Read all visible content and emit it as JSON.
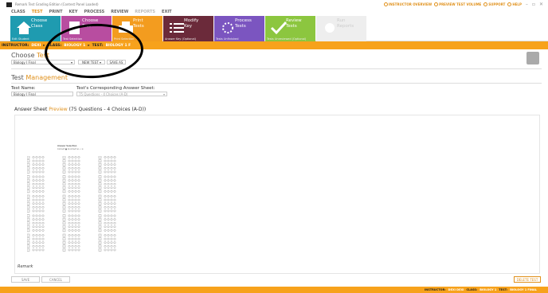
{
  "window": {
    "title": "Remark Test Grading Edition (Contest Panel Loaded)"
  },
  "titlebar_right": {
    "instructor_label": "INSTRUCTOR OVERVIEW",
    "user_label": "PREVIEW TEST VOLUME",
    "support_label": "SUPPORT",
    "help_label": "HELP"
  },
  "menu": [
    "CLASS",
    "TEST",
    "PRINT",
    "KEY",
    "PROCESS",
    "REVIEW",
    "REPORTS",
    "EXIT"
  ],
  "ribbon": [
    {
      "title": "Choose\nClass",
      "sub": "Edit Student",
      "color": "#1f9bb0",
      "icon": "home-icon"
    },
    {
      "title": "Choose\nTest",
      "sub": "Test Selection",
      "color": "#b84da0",
      "icon": "document-icon"
    },
    {
      "title": "Print\nTests",
      "sub": "Print Selection",
      "color": "#f39c1f",
      "icon": "printer-icon"
    },
    {
      "title": "Modify\nKey",
      "sub": "Answer Key (Optional)",
      "color": "#6b2a3a",
      "icon": "list-icon"
    },
    {
      "title": "Process\nTests",
      "sub": "Tests Unfinished",
      "color": "#7b55c0",
      "icon": "process-icon"
    },
    {
      "title": "Review\nTests",
      "sub": "Tests Unreviewed (Optional)",
      "color": "#8cc63f",
      "icon": "check-icon"
    },
    {
      "title": "Run\nReports",
      "sub": "",
      "color": "#eeeeee",
      "icon": "report-icon"
    }
  ],
  "breadcrumb": {
    "instructor_label": "INSTRUCTOR:",
    "instructor": "DEXI",
    "class_label": "CLASS:",
    "class": "BIOLOGY 1",
    "test_label": "TEST:",
    "test": "BIOLOGY 1 F"
  },
  "choose": {
    "heading": "Choose",
    "heading_hl": "Test",
    "select_value": "Biology I Final",
    "new_test": "NEW TEST",
    "save_as": "SAVE AS"
  },
  "management": {
    "heading": "Test",
    "heading_hl": "Management",
    "test_name_label": "Test Name:",
    "test_name_value": "Biology I Final",
    "answer_sheet_label": "Test's Corresponding Answer Sheet:",
    "answer_sheet_value": "75 Questions - 4 Choices (A-D)"
  },
  "preview": {
    "label": "Answer Sheet",
    "label_hl": "Preview",
    "detail": "(75 Questions - 4 Choices (A-D))",
    "sheet_title": "Answer Selection",
    "sheet_legend": "Correct ●  Incorrect ⊗ ✓ ⊘"
  },
  "buttons": {
    "save": "SAVE",
    "cancel": "CANCEL",
    "delete": "DELETE TEST"
  },
  "status": {
    "instructor_label": "INSTRUCTOR:",
    "instructor": "DEXI DEXI",
    "class_label": "CLASS:",
    "class": "BIOLOGY 1",
    "test_label": "TEST:",
    "test": "BIOLOGY 1 FINAL"
  }
}
